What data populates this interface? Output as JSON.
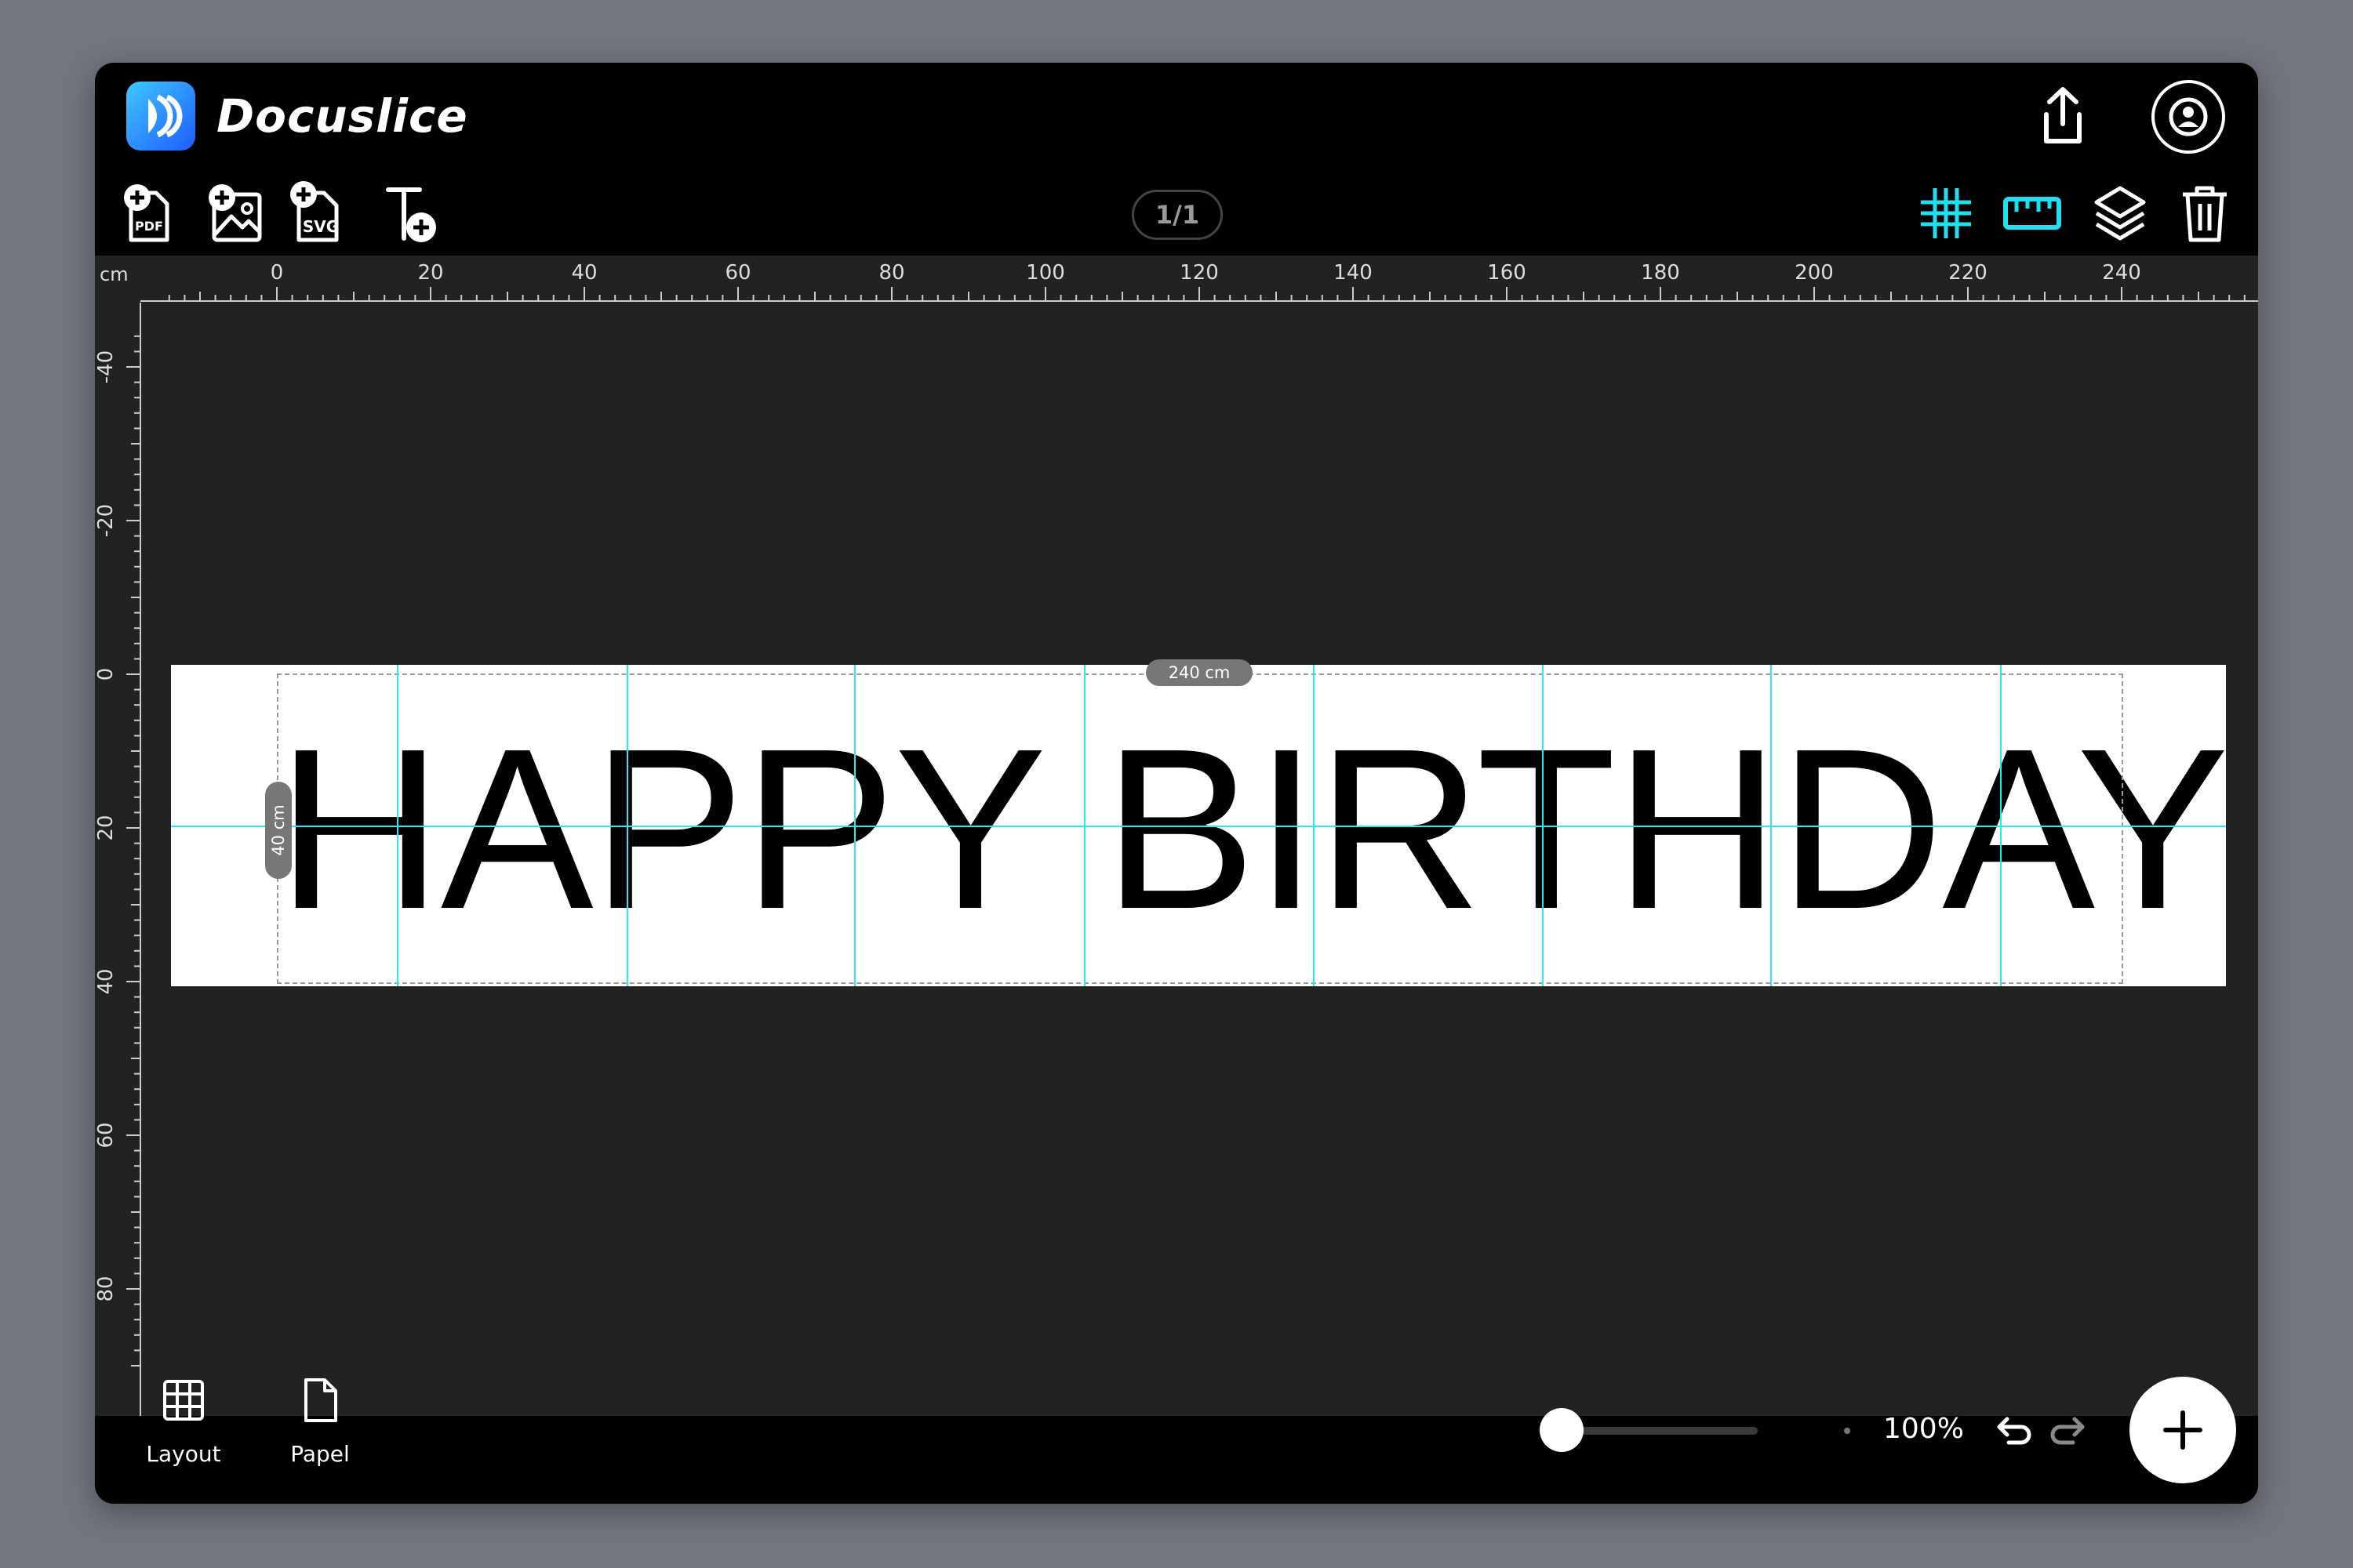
{
  "app": {
    "title": "Docuslice",
    "accent": "#1ee0f0"
  },
  "header": {
    "share_icon": "share-icon",
    "profile_icon": "user-circle-icon"
  },
  "toolbar": {
    "left_tools": [
      {
        "name": "add-pdf",
        "label": "PDF"
      },
      {
        "name": "add-image",
        "label": ""
      },
      {
        "name": "add-svg",
        "label": "SVG"
      },
      {
        "name": "add-text",
        "label": ""
      }
    ],
    "page_indicator": "1/1",
    "right_tools": [
      "grid-icon",
      "ruler-icon",
      "layers-icon",
      "trash-icon"
    ],
    "active_tools": [
      "grid",
      "ruler"
    ]
  },
  "rulers": {
    "unit": "cm",
    "top_labels": [
      "0",
      "20",
      "40",
      "60",
      "80",
      "100",
      "120",
      "140",
      "160",
      "180",
      "200",
      "220",
      "240"
    ],
    "left_labels": [
      "-40",
      "-20",
      "0",
      "20",
      "40",
      "60",
      "80"
    ]
  },
  "canvas": {
    "banner_text": "HAPPY BIRTHDAY",
    "width_label": "240 cm",
    "height_label": "40 cm",
    "guide_color": "#2ee6f5"
  },
  "footer": {
    "items": [
      {
        "label": "Layout",
        "icon": "grid-table-icon"
      },
      {
        "label": "Papel",
        "icon": "document-icon"
      }
    ],
    "zoom": "100%",
    "zoom_level": 0.05,
    "undo_icon": "undo-icon",
    "redo_icon": "redo-icon",
    "fab_icon": "plus-icon"
  }
}
